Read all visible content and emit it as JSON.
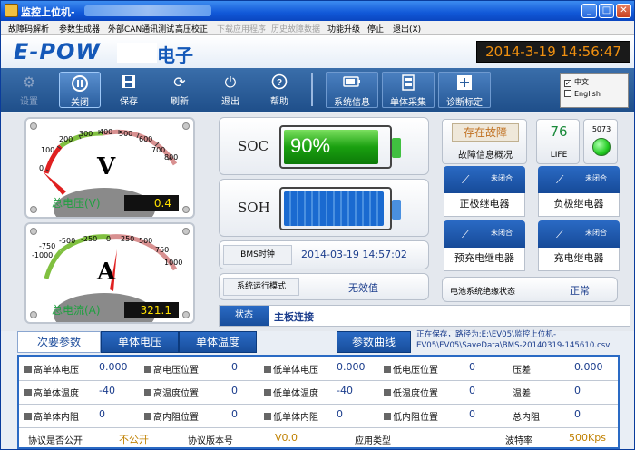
{
  "window": {
    "title": "监控上位机-",
    "controls": {
      "minimize": "_",
      "maximize": "□",
      "close": "✕"
    }
  },
  "menu": {
    "items": [
      {
        "label": "故障码解析",
        "enabled": true
      },
      {
        "label": "参数生成器",
        "enabled": true
      },
      {
        "label": "外部CAN通讯测试",
        "enabled": true
      },
      {
        "label": "高压校正",
        "enabled": true
      },
      {
        "label": "下载应用程序",
        "enabled": false
      },
      {
        "label": "历史故障数据",
        "enabled": false
      },
      {
        "label": "功能升级",
        "enabled": true
      },
      {
        "label": "停止",
        "enabled": true
      },
      {
        "label": "退出(X)",
        "enabled": true
      }
    ]
  },
  "header": {
    "logo": "E-POW",
    "logo_suffix": "电子",
    "datetime": "2014-3-19 14:56:47"
  },
  "toolbar": {
    "settings": "设置",
    "close": "关闭",
    "save": "保存",
    "refresh": "刷新",
    "exit": "退出",
    "help": "帮助",
    "system_info": "系统信息",
    "cell_collect": "单体采集",
    "diag_calibration": "诊断标定",
    "lang_zh": "中文",
    "lang_en": "English"
  },
  "gauges": {
    "voltage": {
      "letter": "V",
      "ticks": [
        "0",
        "100",
        "200",
        "300",
        "400",
        "500",
        "600",
        "700",
        "800"
      ],
      "label": "总电压(V)",
      "value": "0.4"
    },
    "current": {
      "letter": "A",
      "ticks": [
        "-1000",
        "-750",
        "-500",
        "-250",
        "0",
        "250",
        "500",
        "750",
        "1000"
      ],
      "label": "总电流(A)",
      "value": "321.1"
    }
  },
  "soc": {
    "label": "SOC",
    "value": "90%",
    "level": 0.9
  },
  "soh": {
    "label": "SOH",
    "level": 0.95
  },
  "bms_clock": {
    "label": "BMS时钟",
    "value": "2014-03-19 14:57:02"
  },
  "run_mode": {
    "label": "系统运行模式",
    "value": "无效值"
  },
  "status": {
    "label": "状态",
    "value": "主板连接"
  },
  "fault": {
    "state": "存在故障",
    "label": "故障信息概况"
  },
  "life": {
    "value": "76",
    "label": "LIFE"
  },
  "indicator": {
    "value": "5073",
    "color": "#22cc22"
  },
  "relays": [
    {
      "state": "未闭合",
      "name": "正极继电器"
    },
    {
      "state": "未闭合",
      "name": "负极继电器"
    },
    {
      "state": "未闭合",
      "name": "预充电继电器"
    },
    {
      "state": "未闭合",
      "name": "充电继电器"
    }
  ],
  "insulation": {
    "label": "电池系统绝缘状态",
    "value": "正常"
  },
  "tabs": [
    {
      "label": "次要参数",
      "active": true
    },
    {
      "label": "单体电压",
      "active": false
    },
    {
      "label": "单体温度",
      "active": false
    },
    {
      "label": "参数曲线",
      "active": false
    }
  ],
  "save_path": "正在保存，路径为:E:\\EV05\\监控上位机-EV05\\EV05\\SaveData\\BMS-20140319-145610.csv",
  "params": {
    "rows": [
      [
        {
          "label": "高单体电压",
          "value": "0.000"
        },
        {
          "label": "高电压位置",
          "value": "0"
        },
        {
          "label": "低单体电压",
          "value": "0.000"
        },
        {
          "label": "低电压位置",
          "value": "0"
        },
        {
          "label": "压差",
          "value": "0.000"
        }
      ],
      [
        {
          "label": "高单体温度",
          "value": "-40"
        },
        {
          "label": "高温度位置",
          "value": "0"
        },
        {
          "label": "低单体温度",
          "value": "-40"
        },
        {
          "label": "低温度位置",
          "value": "0"
        },
        {
          "label": "温差",
          "value": "0"
        }
      ],
      [
        {
          "label": "高单体内阻",
          "value": "0"
        },
        {
          "label": "高内阻位置",
          "value": "0"
        },
        {
          "label": "低单体内阻",
          "value": "0"
        },
        {
          "label": "低内阻位置",
          "value": "0"
        },
        {
          "label": "总内阻",
          "value": "0"
        }
      ]
    ],
    "footer": [
      {
        "label": "协议是否公开",
        "value": "不公开"
      },
      {
        "label": "协议版本号",
        "value": "V0.0"
      },
      {
        "label": "应用类型",
        "value": ""
      },
      {
        "label": "波特率",
        "value": "500Kps"
      }
    ]
  }
}
